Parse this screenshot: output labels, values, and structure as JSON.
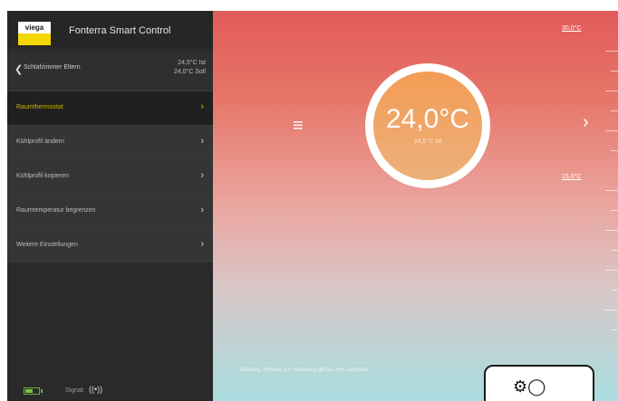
{
  "app": {
    "title": "Fonterra Smart Control",
    "logo_text": "viega"
  },
  "room": {
    "name": "Schlafzimmer Eltern",
    "actual": "24,5°C Ist",
    "target": "24,0°C Soll"
  },
  "menu": [
    {
      "label": "Raumthermostat"
    },
    {
      "label": "Kühlprofil ändern"
    },
    {
      "label": "Kühlprofil kopieren"
    },
    {
      "label": "Raumtemperatur begrenzen"
    },
    {
      "label": "Weitere Einstellungen"
    }
  ],
  "status": {
    "signal_label": "Signal:",
    "battery_level": 0.5
  },
  "thermostat": {
    "set_temp": "24,0°C",
    "actual_temp": "24,5°C ist"
  },
  "scale": {
    "max_label": "30,0°C",
    "min_label": "15,0°C"
  },
  "hint": "Achtung, Hinweis zur Änderung gilt bis zum nächsten",
  "colors": {
    "accent": "#f2d600",
    "active_text": "#c9b400",
    "dial": "#f39c55"
  },
  "icons": {
    "menu": "hamburger-icon",
    "next": "chevron-right-icon",
    "settings": "settings-remote-icon"
  }
}
